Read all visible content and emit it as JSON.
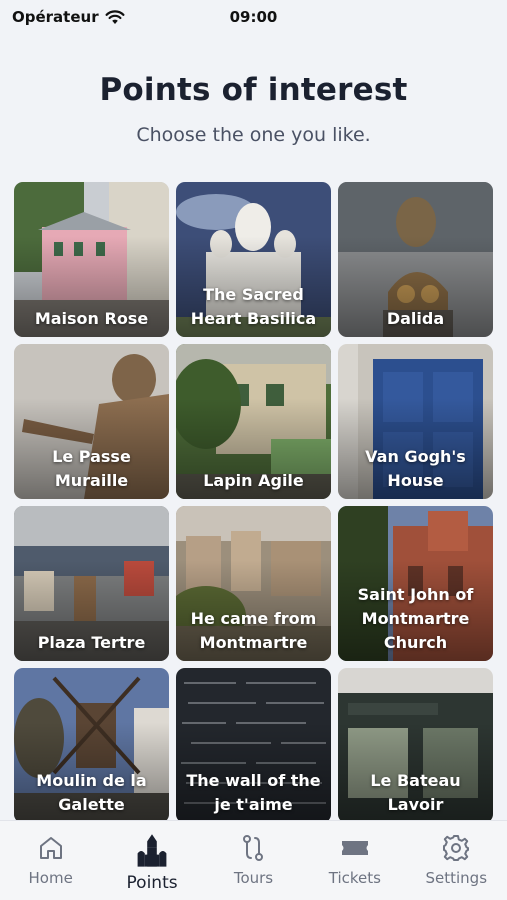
{
  "status": {
    "carrier": "Opérateur",
    "time": "09:00"
  },
  "header": {
    "title": "Points of interest",
    "subtitle": "Choose the one you like."
  },
  "cards": [
    {
      "label": "Maison Rose"
    },
    {
      "label": "The Sacred\nHeart Basilica"
    },
    {
      "label": "Dalida"
    },
    {
      "label": "Le Passe\nMuraille"
    },
    {
      "label": "Lapin Agile"
    },
    {
      "label": "Van Gogh's\nHouse"
    },
    {
      "label": "Plaza Tertre"
    },
    {
      "label": "He came from\nMontmartre"
    },
    {
      "label": "Saint John of\nMontmartre\nChurch"
    },
    {
      "label": "Moulin de la\nGalette"
    },
    {
      "label": "The wall of the\nje t'aime"
    },
    {
      "label": "Le Bateau\nLavoir"
    }
  ],
  "tabbar": {
    "home": "Home",
    "points": "Points",
    "tours": "Tours",
    "tickets": "Tickets",
    "settings": "Settings",
    "active": "points"
  },
  "icons": {
    "home": "home-icon",
    "points": "church-icon",
    "tours": "route-icon",
    "tickets": "ticket-icon",
    "settings": "gear-icon"
  }
}
